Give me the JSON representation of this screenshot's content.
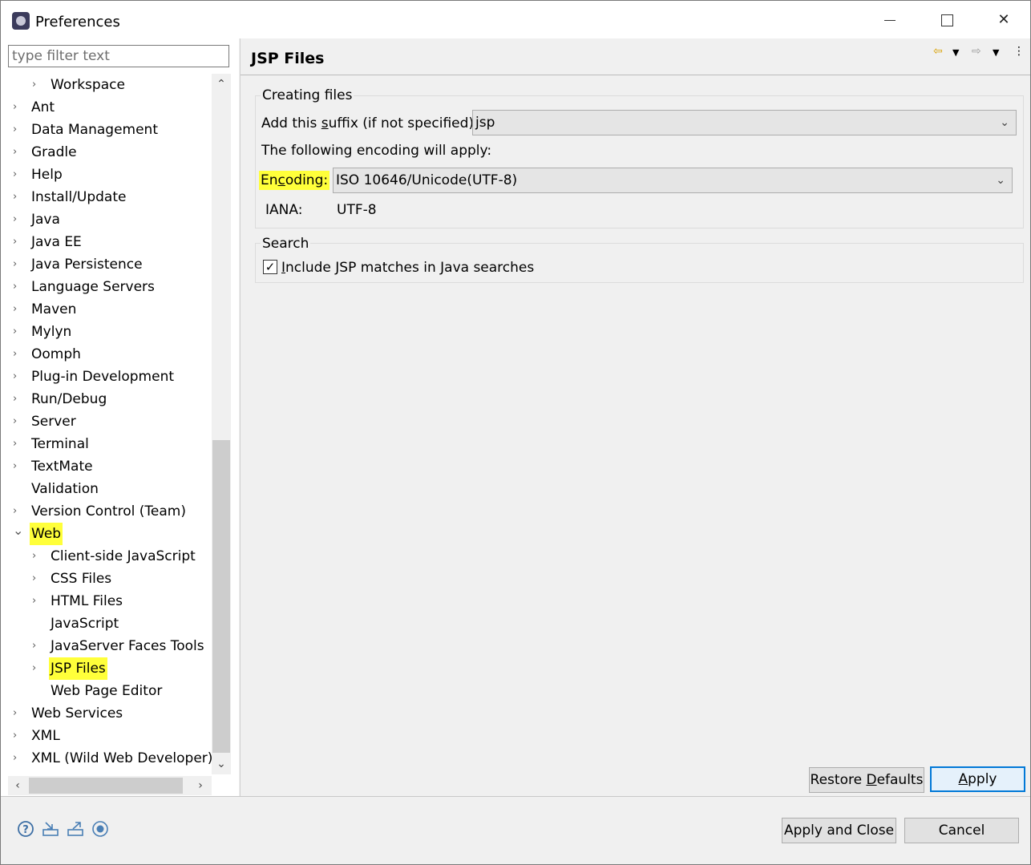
{
  "window": {
    "title": "Preferences",
    "controls": {
      "minimize": "minimize",
      "maximize": "maximize",
      "close": "✕"
    }
  },
  "filter": {
    "placeholder": "type filter text",
    "value": ""
  },
  "tree": {
    "items": [
      {
        "label": "Workspace",
        "level": 1,
        "arrow": "›"
      },
      {
        "label": "Ant",
        "level": 0,
        "arrow": "›"
      },
      {
        "label": "Data Management",
        "level": 0,
        "arrow": "›"
      },
      {
        "label": "Gradle",
        "level": 0,
        "arrow": "›"
      },
      {
        "label": "Help",
        "level": 0,
        "arrow": "›"
      },
      {
        "label": "Install/Update",
        "level": 0,
        "arrow": "›"
      },
      {
        "label": "Java",
        "level": 0,
        "arrow": "›"
      },
      {
        "label": "Java EE",
        "level": 0,
        "arrow": "›"
      },
      {
        "label": "Java Persistence",
        "level": 0,
        "arrow": "›"
      },
      {
        "label": "Language Servers",
        "level": 0,
        "arrow": "›"
      },
      {
        "label": "Maven",
        "level": 0,
        "arrow": "›"
      },
      {
        "label": "Mylyn",
        "level": 0,
        "arrow": "›"
      },
      {
        "label": "Oomph",
        "level": 0,
        "arrow": "›"
      },
      {
        "label": "Plug-in Development",
        "level": 0,
        "arrow": "›"
      },
      {
        "label": "Run/Debug",
        "level": 0,
        "arrow": "›"
      },
      {
        "label": "Server",
        "level": 0,
        "arrow": "›"
      },
      {
        "label": "Terminal",
        "level": 0,
        "arrow": "›"
      },
      {
        "label": "TextMate",
        "level": 0,
        "arrow": "›"
      },
      {
        "label": "Validation",
        "level": 0,
        "arrow": ""
      },
      {
        "label": "Version Control (Team)",
        "level": 0,
        "arrow": "›"
      },
      {
        "label": "Web",
        "level": 0,
        "arrow": "⌄",
        "highlight": true
      },
      {
        "label": "Client-side JavaScript",
        "level": 1,
        "arrow": "›"
      },
      {
        "label": "CSS Files",
        "level": 1,
        "arrow": "›"
      },
      {
        "label": "HTML Files",
        "level": 1,
        "arrow": "›"
      },
      {
        "label": "JavaScript",
        "level": 1,
        "arrow": ""
      },
      {
        "label": "JavaServer Faces Tools",
        "level": 1,
        "arrow": "›"
      },
      {
        "label": "JSP Files",
        "level": 1,
        "arrow": "›",
        "highlight": true
      },
      {
        "label": "Web Page Editor",
        "level": 1,
        "arrow": ""
      },
      {
        "label": "Web Services",
        "level": 0,
        "arrow": "›"
      },
      {
        "label": "XML",
        "level": 0,
        "arrow": "›"
      },
      {
        "label": "XML (Wild Web Developer)",
        "level": 0,
        "arrow": "›"
      }
    ]
  },
  "page": {
    "title": "JSP Files",
    "creating_files": {
      "group_title": "Creating files",
      "suffix_label_pre": "Add this ",
      "suffix_label_mnemonic": "s",
      "suffix_label_post": "uffix (if not specified):",
      "suffix_value": "jsp",
      "encoding_note": "The following encoding will apply:",
      "encoding_label_pre": "En",
      "encoding_label_mnemonic": "c",
      "encoding_label_post": "oding:",
      "encoding_value": "ISO 10646/Unicode(UTF-8)",
      "iana_label": "IANA:",
      "iana_value": "UTF-8"
    },
    "search": {
      "group_title": "Search",
      "checkbox_mnemonic": "I",
      "checkbox_label_post": "nclude JSP matches in Java searches",
      "checked": true
    },
    "buttons": {
      "restore_pre": "Restore ",
      "restore_mnemonic": "D",
      "restore_post": "efaults",
      "apply_mnemonic": "A",
      "apply_post": "pply"
    }
  },
  "footer": {
    "apply_and_close": "Apply and Close",
    "cancel": "Cancel",
    "icons": [
      "help-icon",
      "import-icon",
      "export-icon",
      "record-icon"
    ]
  },
  "colors": {
    "highlight": "#ffff3a",
    "default_button_border": "#0078d7"
  }
}
